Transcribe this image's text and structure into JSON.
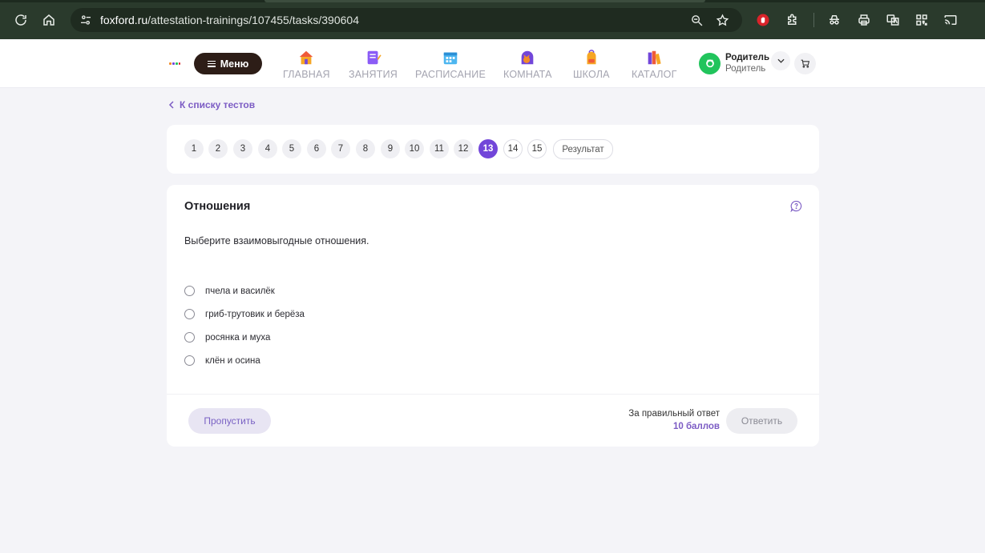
{
  "browser": {
    "url_host": "foxford.ru",
    "url_path": "/attestation-trainings/107455/tasks/390604",
    "icons": [
      "reload-icon",
      "home-icon",
      "site-info-icon",
      "zoom-icon",
      "bookmark-star-icon",
      "adblock-icon",
      "extensions-icon",
      "incognito-icon",
      "print-icon",
      "translate-icon",
      "qr-code-icon",
      "cast-icon"
    ]
  },
  "header": {
    "menu_label": "Меню",
    "nav": [
      {
        "label": "ГЛАВНАЯ",
        "icon": "house-icon"
      },
      {
        "label": "ЗАНЯТИЯ",
        "icon": "notebook-icon"
      },
      {
        "label": "РАСПИСАНИЕ",
        "icon": "calendar-icon"
      },
      {
        "label": "КОМНАТА",
        "icon": "fox-room-icon"
      },
      {
        "label": "ШКОЛА",
        "icon": "backpack-icon"
      },
      {
        "label": "КАТАЛОГ",
        "icon": "books-icon"
      }
    ],
    "profile": {
      "name": "Родитель",
      "role": "Родитель"
    },
    "cart_icon": "cart-icon"
  },
  "content": {
    "back_link": "К списку тестов",
    "question_numbers": [
      "1",
      "2",
      "3",
      "4",
      "5",
      "6",
      "7",
      "8",
      "9",
      "10",
      "11",
      "12",
      "13",
      "14",
      "15"
    ],
    "active_question": "13",
    "result_label": "Результат",
    "question": {
      "title": "Отношения",
      "text": "Выберите взаимовыгодные отношения.",
      "options": [
        "пчела и василёк",
        "гриб-трутовик и берёза",
        "росянка и муха",
        "клён и осина"
      ]
    },
    "footer": {
      "skip_label": "Пропустить",
      "points_label": "За правильный ответ",
      "points_value": "10 баллов",
      "answer_label": "Ответить"
    }
  },
  "colors": {
    "accent": "#7246d9",
    "link": "#7c5cc4",
    "chrome_bg": "#2a3a2c",
    "page_bg": "#f4f4f8"
  }
}
